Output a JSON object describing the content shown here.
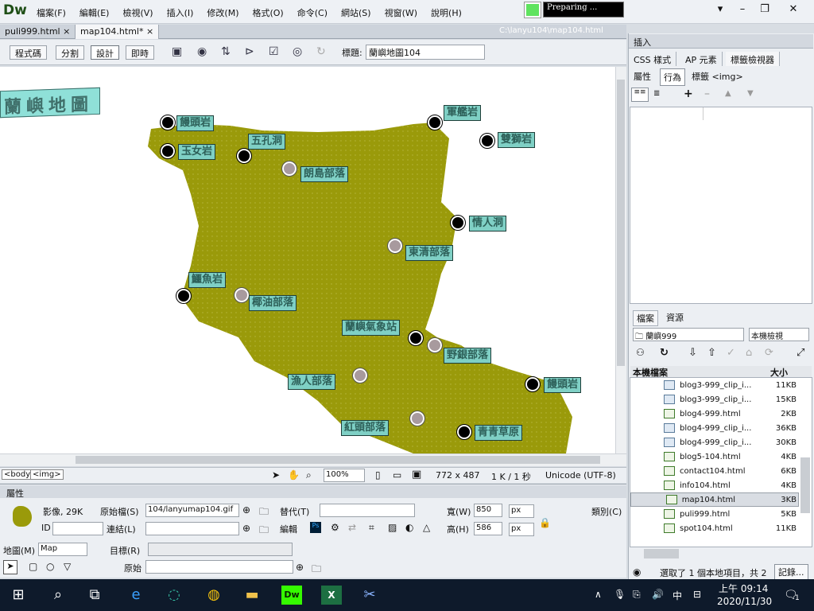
{
  "app": {
    "logo": "Dw",
    "status_label": "Preparing ..."
  },
  "menu": [
    "檔案(F)",
    "編輯(E)",
    "檢視(V)",
    "插入(I)",
    "修改(M)",
    "格式(O)",
    "命令(C)",
    "網站(S)",
    "視窗(W)",
    "說明(H)"
  ],
  "window_buttons": {
    "minimize": "–",
    "restore": "❐",
    "close": "✕",
    "dropdown": "▾"
  },
  "doc_tabs": [
    {
      "label": "puli999.html",
      "close": "×"
    },
    {
      "label": "map104.html*",
      "close": "×"
    }
  ],
  "doc_path": "C:\\lanyu104\\map104.html",
  "toolbar": {
    "views": [
      "程式碼",
      "分割",
      "設計",
      "即時"
    ],
    "title_label": "標題:",
    "title_value": "蘭嶼地圖104"
  },
  "map": {
    "title": "蘭嶼地圖",
    "labels": [
      "饅頭岩",
      "軍艦岩",
      "五孔洞",
      "玉女岩",
      "雙獅岩",
      "朗島部落",
      "情人洞",
      "東清部落",
      "鱷魚岩",
      "椰油部落",
      "蘭嶼氣象站",
      "野銀部落",
      "漁人部落",
      "饅頭岩",
      "紅頭部落",
      "青青草原"
    ],
    "island_color": "#9a9a0a"
  },
  "status": {
    "tags": [
      "<body>",
      "<img>"
    ],
    "zoom": "100%",
    "dimensions": "772 x 487",
    "size_time": "1 K / 1 秒",
    "encoding": "Unicode (UTF-8)"
  },
  "props": {
    "title": "屬性",
    "kind": "影像, 29K",
    "src_label": "原始檔(S)",
    "src_value": "104/lanyumap104.gif",
    "alt_label": "替代(T)",
    "width_label": "寬(W)",
    "width_value": "850",
    "height_label": "高(H)",
    "height_value": "586",
    "unit": "px",
    "class_label": "類別(C)",
    "id_label": "ID",
    "link_label": "連結(L)",
    "edit_label": "編輯",
    "map_label": "地圖(M)",
    "map_value": "Map",
    "target_label": "目標(R)",
    "original_label": "原始"
  },
  "right_panel": {
    "insert_label": "插入",
    "tabs": [
      "CSS 樣式",
      "AP 元素",
      "標籤檢視器"
    ],
    "subtabs": [
      "屬性",
      "行為"
    ],
    "tag_label": "標籤 <img>",
    "files_tabs": [
      "檔案",
      "資源"
    ],
    "site_select": "蘭嶼999",
    "view_select": "本機檢視",
    "list_header": "本機檔案",
    "size_header": "大小",
    "files": [
      {
        "name": "blog3-999_clip_i...",
        "size": "11KB"
      },
      {
        "name": "blog3-999_clip_i...",
        "size": "15KB"
      },
      {
        "name": "blog4-999.html",
        "size": "2KB"
      },
      {
        "name": "blog4-999_clip_i...",
        "size": "36KB"
      },
      {
        "name": "blog4-999_clip_i...",
        "size": "30KB"
      },
      {
        "name": "blog5-104.html",
        "size": "4KB"
      },
      {
        "name": "contact104.html",
        "size": "6KB"
      },
      {
        "name": "info104.html",
        "size": "4KB"
      },
      {
        "name": "map104.html",
        "size": "3KB"
      },
      {
        "name": "puli999.html",
        "size": "5KB"
      },
      {
        "name": "spot104.html",
        "size": "11KB"
      }
    ],
    "footer_text": "選取了 1 個本地項目，共 2",
    "log_button": "記錄..."
  },
  "taskbar": {
    "time": "上午 09:14",
    "date": "2020/11/30",
    "ime": "中",
    "notify_count": "1"
  }
}
